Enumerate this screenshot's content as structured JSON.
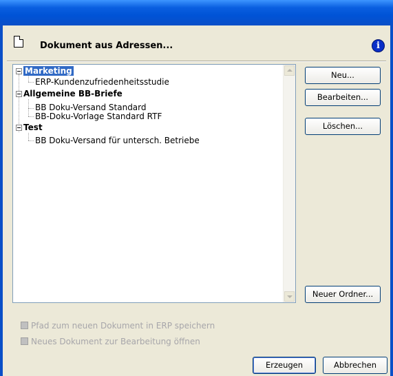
{
  "dialog": {
    "title": "Dokument aus Adressen..."
  },
  "tree": {
    "items": [
      {
        "label": "Marketing",
        "folder": true,
        "selected": true
      },
      {
        "label": "ERP-Kundenzufriedenheitsstudie",
        "folder": false
      },
      {
        "label": "Allgemeine BB-Briefe",
        "folder": true
      },
      {
        "label": "BB Doku-Versand Standard",
        "folder": false
      },
      {
        "label": "BB-Doku-Vorlage Standard RTF",
        "folder": false
      },
      {
        "label": "Test",
        "folder": true
      },
      {
        "label": "BB Doku-Versand für untersch. Betriebe",
        "folder": false
      }
    ]
  },
  "buttons": {
    "new": "Neu...",
    "edit": "Bearbeiten...",
    "delete": "Löschen...",
    "new_folder": "Neuer Ordner...",
    "create": "Erzeugen",
    "cancel": "Abbrechen"
  },
  "options": {
    "save_path": "Pfad zum neuen Dokument in ERP speichern",
    "open_edit": "Neues Dokument zur Bearbeitung öffnen"
  },
  "colors": {
    "selection": "#316AC5",
    "dialog_bg": "#ECE9D8",
    "title_bar": "#0A5FE0"
  }
}
